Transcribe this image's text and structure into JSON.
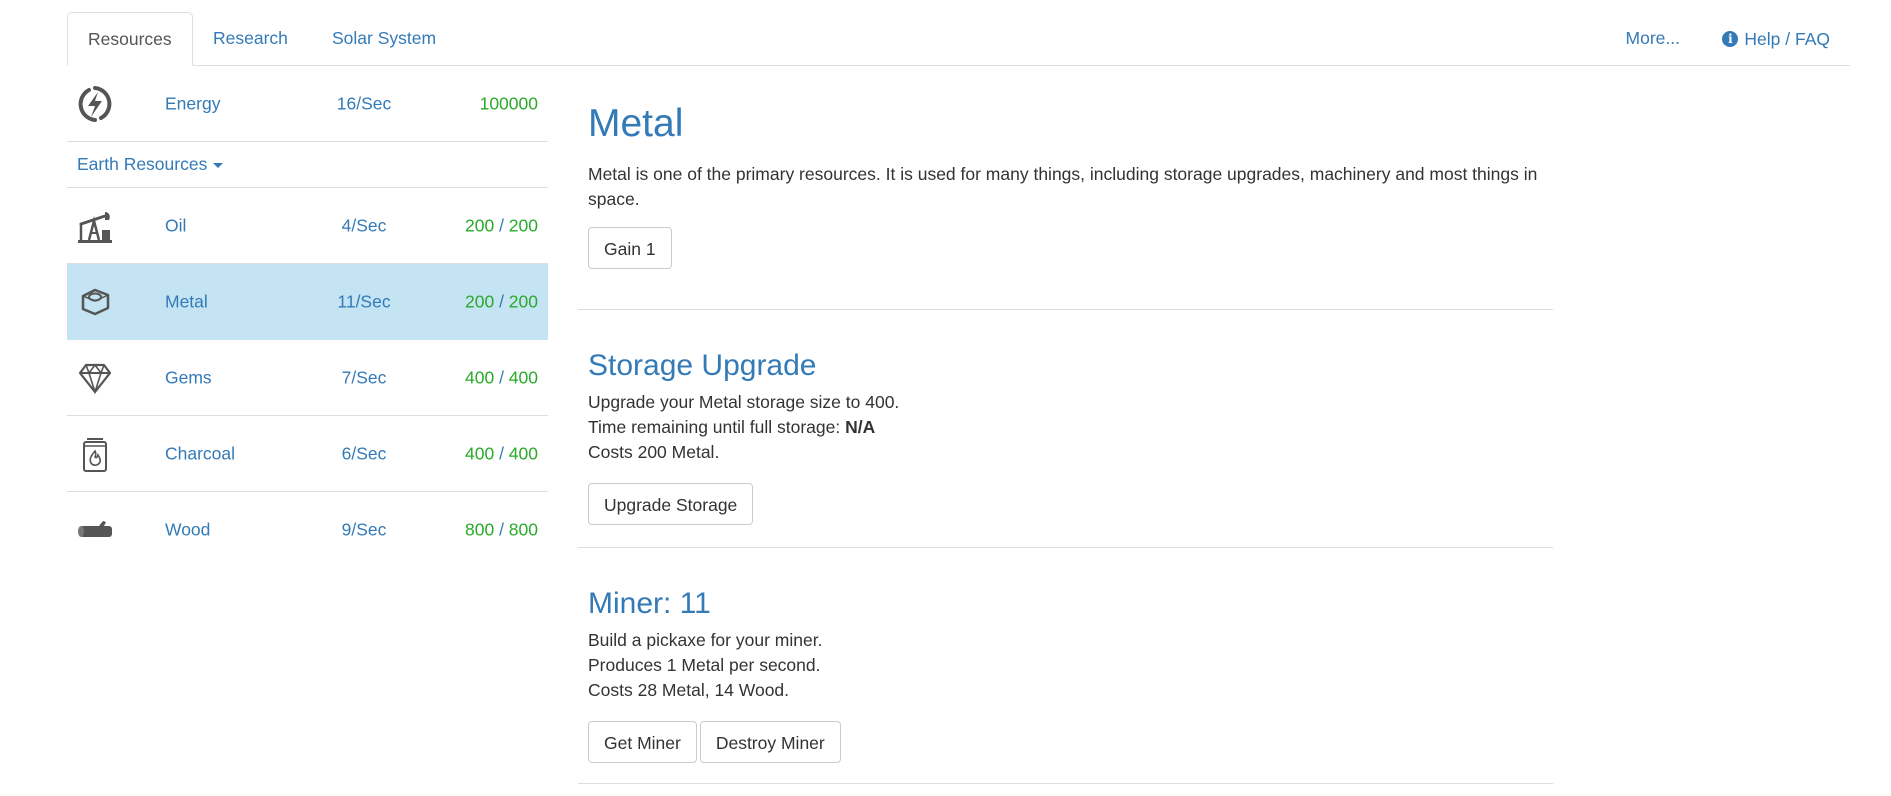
{
  "nav": {
    "tabs": [
      {
        "label": "Resources",
        "active": true
      },
      {
        "label": "Research"
      },
      {
        "label": "Solar System"
      }
    ],
    "right": {
      "more_label": "More...",
      "help_label": "Help / FAQ",
      "help_icon": "info-circle-icon"
    }
  },
  "resources": {
    "energy": {
      "name": "Energy",
      "rate": "16/Sec",
      "amount": "100000",
      "icon": "lightning-bolt-icon"
    },
    "category_label": "Earth Resources",
    "items": [
      {
        "name": "Oil",
        "rate": "4/Sec",
        "current": "200",
        "max": "200",
        "icon": "oil-pump-icon"
      },
      {
        "name": "Metal",
        "rate": "11/Sec",
        "current": "200",
        "max": "200",
        "icon": "metal-nut-icon",
        "active": true
      },
      {
        "name": "Gems",
        "rate": "7/Sec",
        "current": "400",
        "max": "400",
        "icon": "gem-icon"
      },
      {
        "name": "Charcoal",
        "rate": "6/Sec",
        "current": "400",
        "max": "400",
        "icon": "charcoal-bag-icon"
      },
      {
        "name": "Wood",
        "rate": "9/Sec",
        "current": "800",
        "max": "800",
        "icon": "wood-log-icon"
      }
    ],
    "separator": " / "
  },
  "main": {
    "resource": {
      "title": "Metal",
      "description": "Metal is one of the primary resources. It is used for many things, including storage upgrades, machinery and most things in space.",
      "gain_label": "Gain 1"
    },
    "storage": {
      "title": "Storage Upgrade",
      "line1": "Upgrade your Metal storage size to 400.",
      "line2_prefix": "Time remaining until full storage: ",
      "line2_value": "N/A",
      "line3": "Costs 200 Metal.",
      "button_label": "Upgrade Storage"
    },
    "miner": {
      "title": "Miner: 11",
      "line1": "Build a pickaxe for your miner.",
      "line2": "Produces 1 Metal per second.",
      "line3": "Costs 28 Metal, 14 Wood.",
      "get_label": "Get Miner",
      "destroy_label": "Destroy Miner"
    }
  },
  "colors": {
    "link": "#337ab7",
    "active_row": "#c4e3f3",
    "amount_green": "#2aa92a",
    "icon_gray": "#555555"
  }
}
